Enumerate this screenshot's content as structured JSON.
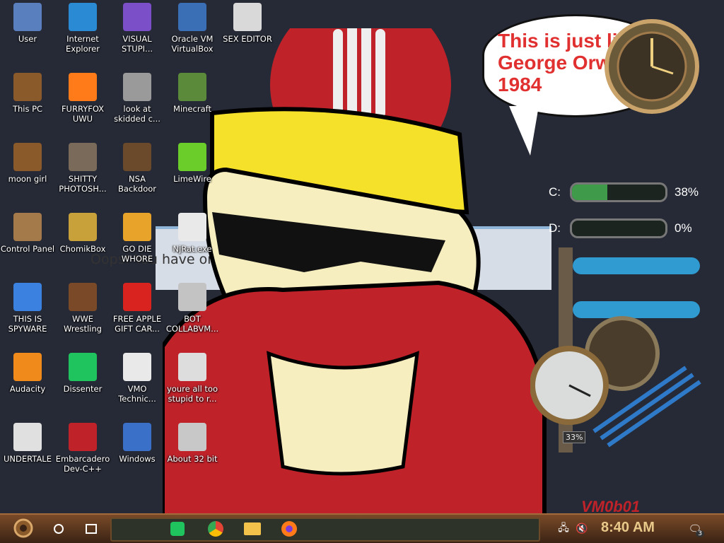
{
  "wallpaper": {
    "message": "Oops! You have one. It's been deemed inap",
    "bubble_text": "This is just like George Orwell's 1984",
    "vm_label": "VM0b01"
  },
  "meters": [
    {
      "drive": "C:",
      "percent": "38%",
      "fill_fraction": 0.38
    },
    {
      "drive": "D:",
      "percent": "0%",
      "fill_fraction": 0.0
    }
  ],
  "gauge_readout": "33%",
  "icons": [
    {
      "id": "user",
      "label": "User",
      "color": "#5a7fbf"
    },
    {
      "id": "ie",
      "label": "Internet Explorer",
      "color": "#2a8ad4"
    },
    {
      "id": "vs",
      "label": "VISUAL STUPI...",
      "color": "#7a4fc7"
    },
    {
      "id": "vbox",
      "label": "Oracle VM VirtualBox",
      "color": "#3a6eb5"
    },
    {
      "id": "sex",
      "label": "SEX EDITOR",
      "color": "#d9d9d9"
    },
    {
      "id": "pc",
      "label": "This PC",
      "color": "#8a5a2a"
    },
    {
      "id": "firefox",
      "label": "FURRYFOX UWU",
      "color": "#ff7b1a"
    },
    {
      "id": "lookat",
      "label": "look at skidded c...",
      "color": "#9a9a9a"
    },
    {
      "id": "minecraft",
      "label": "Minecraft",
      "color": "#5a8a3a"
    },
    {
      "id": "moongirl",
      "label": "moon girl",
      "color": "#8a5a2a"
    },
    {
      "id": "gimp",
      "label": "SHITTY PHOTOSH...",
      "color": "#7a6a5a"
    },
    {
      "id": "nsa",
      "label": "NSA Backdoor",
      "color": "#6a4a2a"
    },
    {
      "id": "limewire",
      "label": "LimeWire",
      "color": "#6acd2a"
    },
    {
      "id": "cpanel",
      "label": "Control Panel",
      "color": "#a57a4a"
    },
    {
      "id": "chomik",
      "label": "ChomikBox",
      "color": "#c9a13a"
    },
    {
      "id": "godie",
      "label": "GO DIE WHORE",
      "color": "#e8a32a"
    },
    {
      "id": "njrat",
      "label": "NjRat.exe",
      "color": "#e9e9e9"
    },
    {
      "id": "chrome",
      "label": "THIS IS SPYWARE",
      "color": "#3b82e0"
    },
    {
      "id": "wwe",
      "label": "WWE Wrestling",
      "color": "#7a4a28"
    },
    {
      "id": "apple",
      "label": "FREE APPLE GIFT CAR...",
      "color": "#d9231f"
    },
    {
      "id": "bot",
      "label": "BOT COLLABVM...",
      "color": "#c3c3c3"
    },
    {
      "id": "audacity",
      "label": "Audacity",
      "color": "#f08a1a"
    },
    {
      "id": "dissenter",
      "label": "Dissenter",
      "color": "#1fc45e"
    },
    {
      "id": "vmo",
      "label": "VMO Technic...",
      "color": "#e9e9e9"
    },
    {
      "id": "stupid",
      "label": "youre all too stupid to r...",
      "color": "#dddddd"
    },
    {
      "id": "undertale",
      "label": "UNDERTALE",
      "color": "#e0e0e0"
    },
    {
      "id": "devc",
      "label": "Embarcadero Dev-C++",
      "color": "#c0222a"
    },
    {
      "id": "winshield",
      "label": "Windows",
      "color": "#3a70c8"
    },
    {
      "id": "bit32",
      "label": "About 32 bit",
      "color": "#c8c8c8"
    }
  ],
  "taskbar": {
    "time": "8:40 AM",
    "notification_count": "3"
  }
}
